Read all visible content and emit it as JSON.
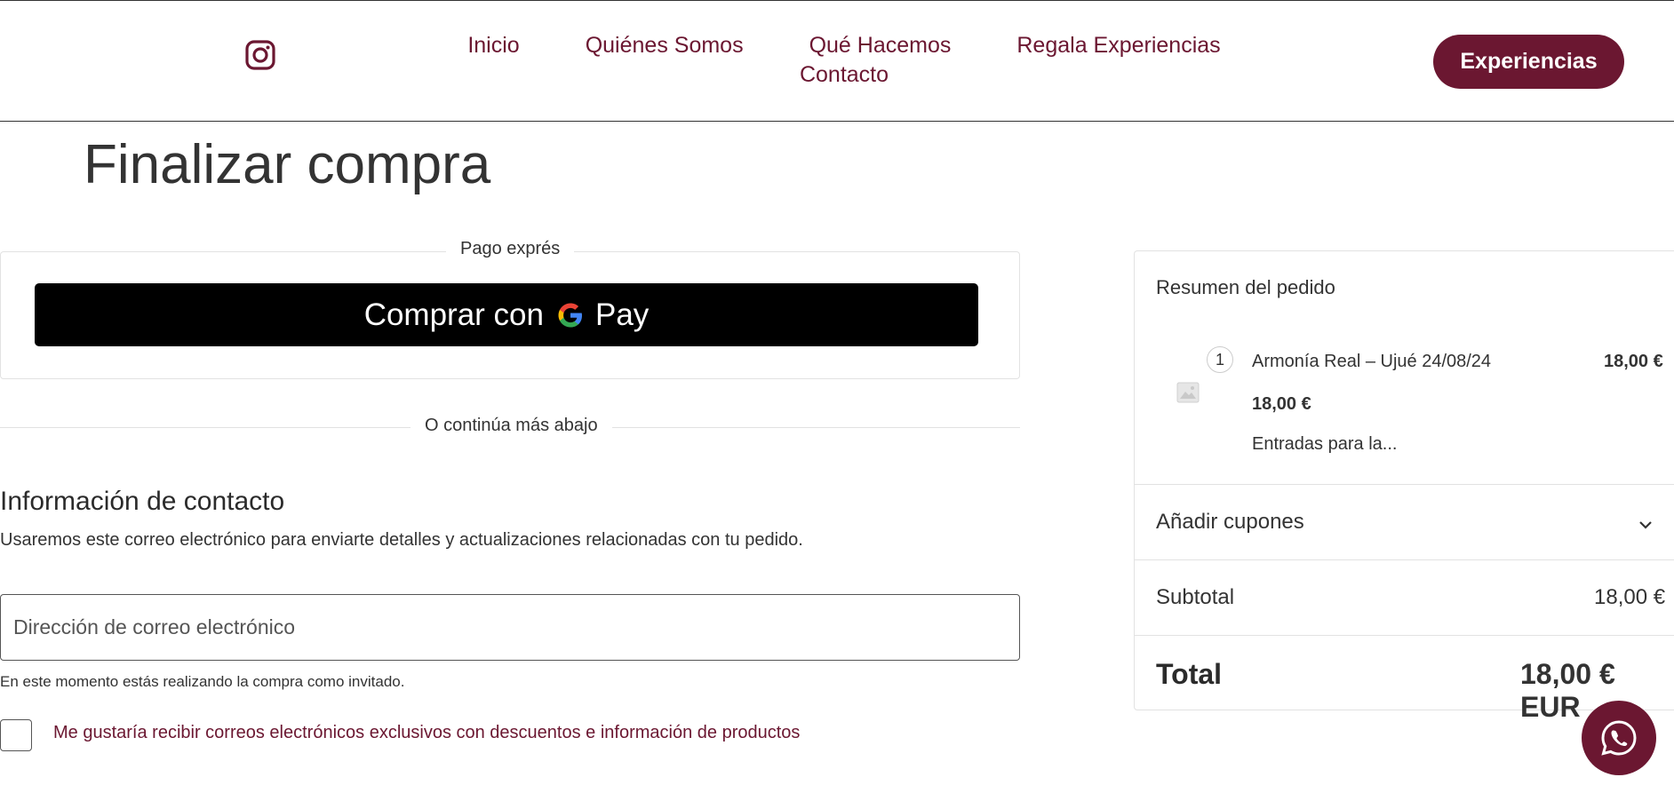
{
  "header": {
    "nav": [
      "Inicio",
      "Quiénes Somos",
      "Qué Hacemos",
      "Regala Experiencias",
      "Contacto"
    ],
    "cta_label": "Experiencias",
    "social_icon": "instagram-icon"
  },
  "page_title": "Finalizar compra",
  "express": {
    "label": "Pago exprés",
    "gpay_text": "Comprar con",
    "gpay_pay": "Pay",
    "divider_label": "O continúa más abajo"
  },
  "contact": {
    "title": "Información de contacto",
    "description": "Usaremos este correo electrónico para enviarte detalles y actualizaciones relacionadas con tu pedido.",
    "email_placeholder": "Dirección de correo electrónico",
    "email_value": "",
    "guest_note": "En este momento estás realizando la compra como invitado.",
    "newsletter_label": "Me gustaría recibir correos electrónicos exclusivos con descuentos e información de productos",
    "newsletter_checked": false
  },
  "summary": {
    "title": "Resumen del pedido",
    "item": {
      "quantity": "1",
      "name": "Armonía Real – Ujué 24/08/24",
      "price": "18,00 €",
      "unit_price": "18,00 €",
      "description": "Entradas para la..."
    },
    "coupons_label": "Añadir cupones",
    "subtotal_label": "Subtotal",
    "subtotal_value": "18,00 €",
    "total_label": "Total",
    "total_value": "18,00 € EUR"
  },
  "colors": {
    "brand": "#6b1731",
    "gpay_bg": "#000000"
  }
}
